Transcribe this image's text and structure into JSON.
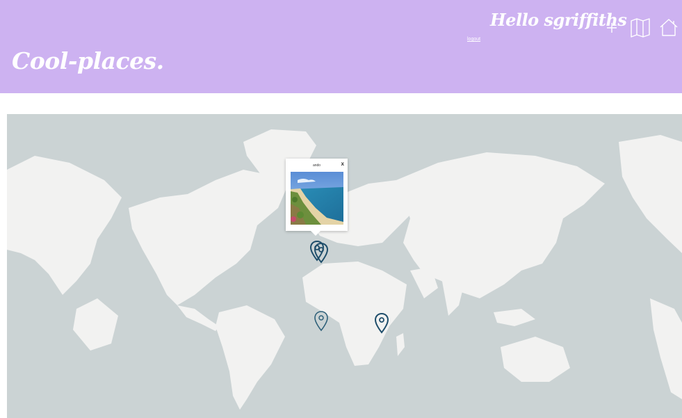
{
  "header": {
    "brand": "Cool-places.",
    "greeting": "Hello sgriffiths",
    "logout_label": "logout",
    "nav_icons": [
      "plus-icon",
      "map-icon",
      "home-icon"
    ]
  },
  "popup": {
    "title": "ando",
    "close_label": "x",
    "image": "beach-photo"
  },
  "colors": {
    "header_bg": "#cdb2f1",
    "header_text": "#ffffff",
    "map_water": "#cbd3d4",
    "map_land": "#f2f2f1",
    "marker": "#1f4e6b"
  },
  "map": {
    "markers": [
      {
        "name": "marker-europe-1"
      },
      {
        "name": "marker-europe-2"
      },
      {
        "name": "marker-west-africa"
      },
      {
        "name": "marker-east-africa"
      }
    ]
  }
}
